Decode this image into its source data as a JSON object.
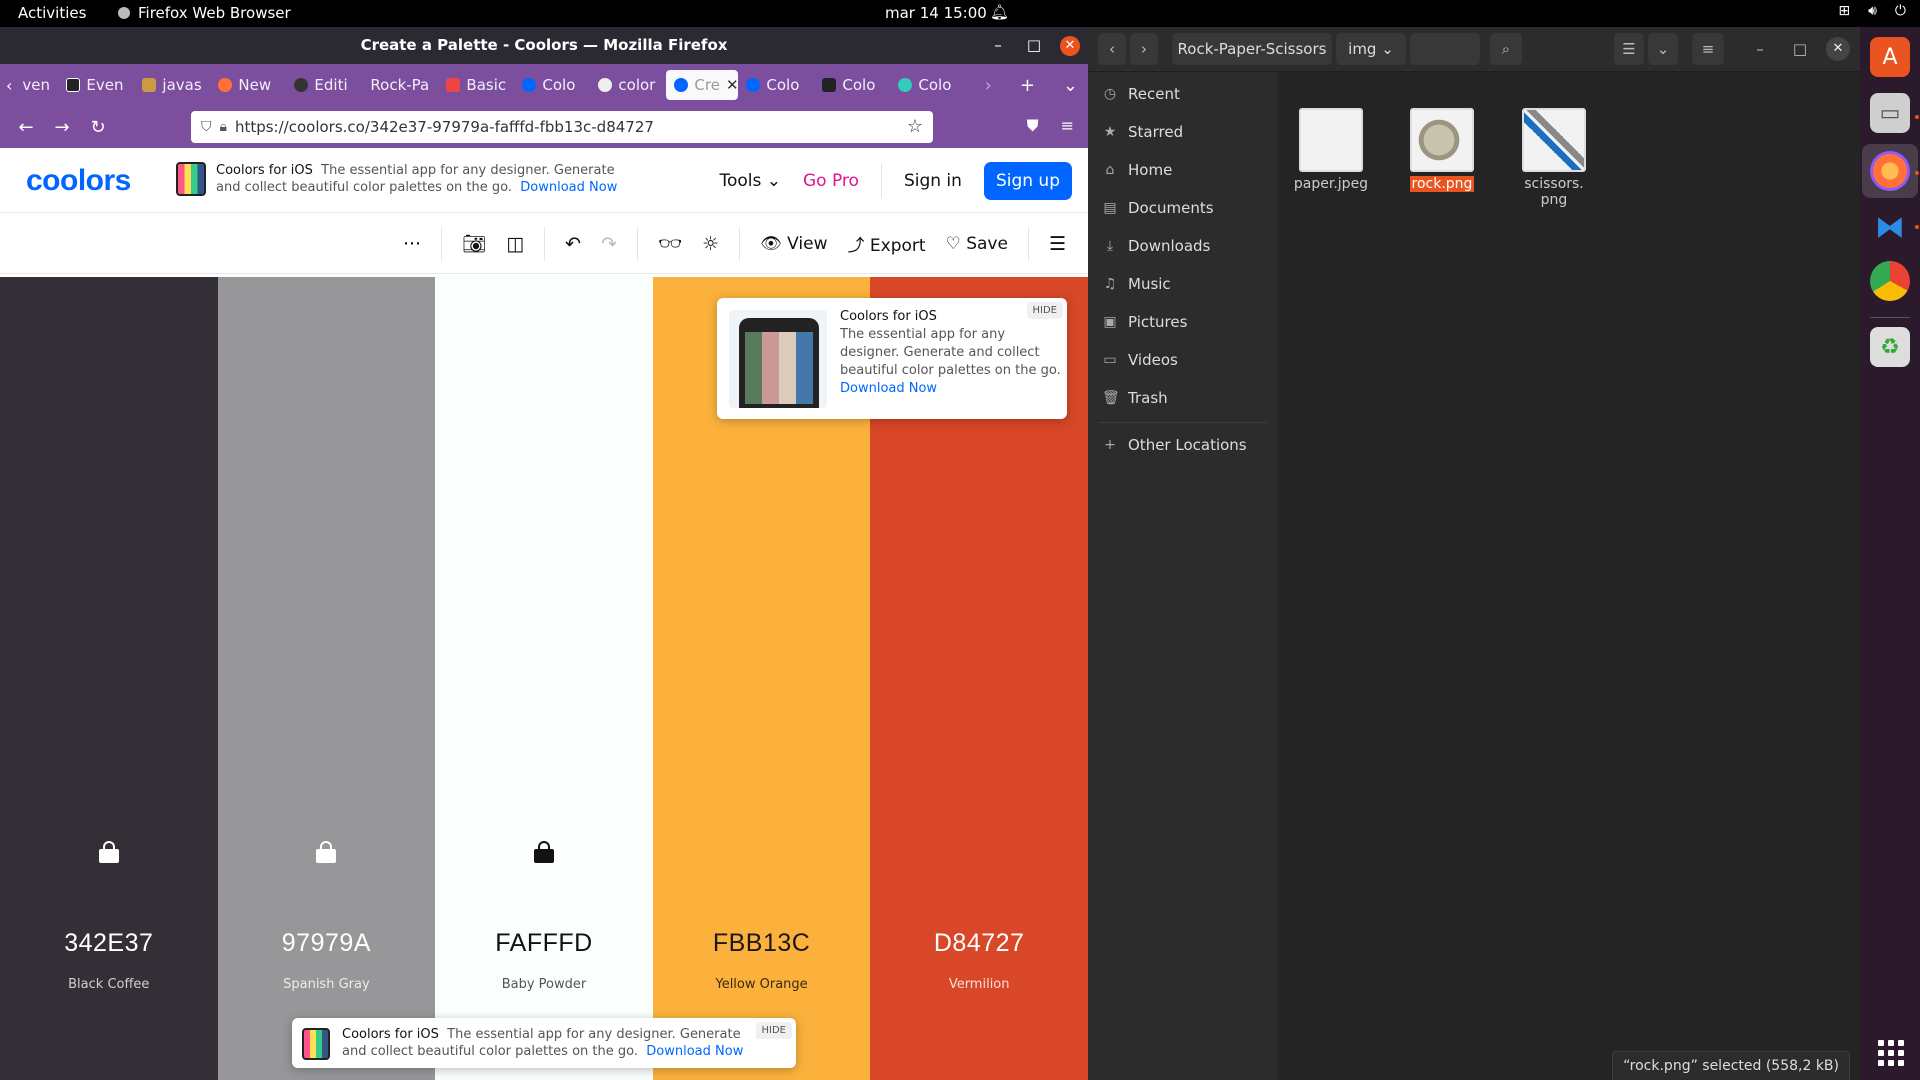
{
  "topbar": {
    "activities": "Activities",
    "app_name": "Firefox Web Browser",
    "clock": "mar 14  15:00"
  },
  "firefox": {
    "window_title": "Create a Palette - Coolors — Mozilla Firefox",
    "tabs": [
      {
        "label": "ven",
        "icon_color": "#888"
      },
      {
        "label": "Even",
        "icon_color": "#222"
      },
      {
        "label": "javas",
        "icon_color": "#c94"
      },
      {
        "label": "New",
        "icon_color": "#ff7139"
      },
      {
        "label": "Editi",
        "icon_color": "#333"
      },
      {
        "label": "Rock-Pa",
        "icon_color": ""
      },
      {
        "label": "Basic",
        "icon_color": "#e44"
      },
      {
        "label": "Colo",
        "icon_color": "#0066ff"
      },
      {
        "label": "color",
        "icon_color": "#eee"
      },
      {
        "label": "Cre",
        "icon_color": "#0066ff"
      },
      {
        "label": "Colo",
        "icon_color": "#0066ff"
      },
      {
        "label": "Colo",
        "icon_color": "#222"
      },
      {
        "label": "Colo",
        "icon_color": "#3cb"
      }
    ],
    "url": "https://coolors.co/342e37-97979a-fafffd-fbb13c-d84727"
  },
  "coolors": {
    "logo": "coolors",
    "promo": {
      "title": "Coolors for iOS",
      "text": "The essential app for any designer. Generate and collect beautiful color palettes on the go.",
      "link": "Download Now",
      "hide": "HIDE"
    },
    "nav": {
      "tools": "Tools",
      "gopro": "Go Pro",
      "signin": "Sign in",
      "signup": "Sign up"
    },
    "toolbar": {
      "view": "View",
      "export": "Export",
      "save": "Save"
    },
    "palette": [
      {
        "hex": "342E37",
        "name": "Black Coffee",
        "color": "#342e37",
        "text_color": "#ffffff",
        "name_color": "#cfcfd2"
      },
      {
        "hex": "97979A",
        "name": "Spanish Gray",
        "color": "#97979a",
        "text_color": "#ffffff",
        "name_color": "#ececec"
      },
      {
        "hex": "FAFFFD",
        "name": "Baby Powder",
        "color": "#fafffd",
        "text_color": "#111111",
        "name_color": "#555555"
      },
      {
        "hex": "FBB13C",
        "name": "Yellow Orange",
        "color": "#fbb13c",
        "text_color": "#1a1a1a",
        "name_color": "#3a2a10"
      },
      {
        "hex": "D84727",
        "name": "Vermilion",
        "color": "#d84727",
        "text_color": "#ffffff",
        "name_color": "#fbe0d8"
      }
    ]
  },
  "files": {
    "path": [
      "Rock-Paper-Scissors",
      "img"
    ],
    "sidebar": [
      {
        "label": "Recent",
        "icon": "clock-icon"
      },
      {
        "label": "Starred",
        "icon": "star-icon"
      },
      {
        "label": "Home",
        "icon": "home-icon"
      },
      {
        "label": "Documents",
        "icon": "document-icon"
      },
      {
        "label": "Downloads",
        "icon": "download-icon"
      },
      {
        "label": "Music",
        "icon": "music-icon"
      },
      {
        "label": "Pictures",
        "icon": "picture-icon"
      },
      {
        "label": "Videos",
        "icon": "video-icon"
      },
      {
        "label": "Trash",
        "icon": "trash-icon"
      },
      {
        "label": "Other Locations",
        "icon": "plus-icon"
      }
    ],
    "items": [
      {
        "name": "paper.jpeg",
        "selected": false
      },
      {
        "name": "rock.png",
        "selected": true
      },
      {
        "name": "scissors.\npng",
        "selected": false
      }
    ],
    "status": "“rock.png” selected  (558,2 kB)"
  }
}
